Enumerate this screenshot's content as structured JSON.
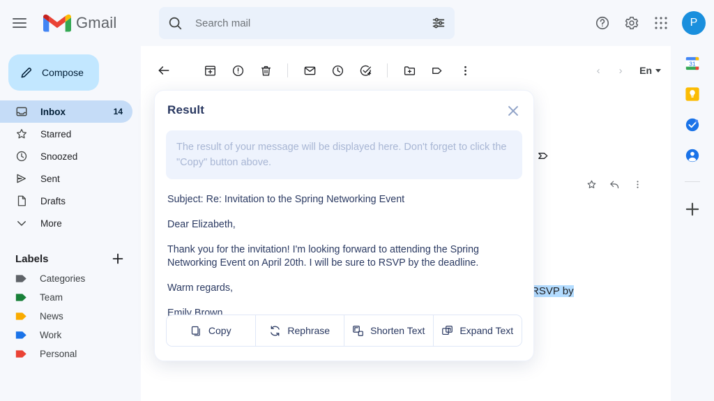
{
  "app": {
    "brand_name": "Gmail",
    "avatar_initial": "P"
  },
  "search": {
    "placeholder": "Search mail",
    "value": ""
  },
  "sidebar": {
    "compose_label": "Compose",
    "items": [
      {
        "label": "Inbox",
        "count": "14",
        "icon": "inbox-icon",
        "active": true
      },
      {
        "label": "Starred",
        "count": "",
        "icon": "star-icon",
        "active": false
      },
      {
        "label": "Snoozed",
        "count": "",
        "icon": "clock-icon",
        "active": false
      },
      {
        "label": "Sent",
        "count": "",
        "icon": "send-icon",
        "active": false
      },
      {
        "label": "Drafts",
        "count": "",
        "icon": "draft-icon",
        "active": false
      },
      {
        "label": "More",
        "count": "",
        "icon": "chevron-down-icon",
        "active": false
      }
    ],
    "labels_header": "Labels",
    "labels": [
      {
        "label": "Categories",
        "color": "#5f6368"
      },
      {
        "label": "Team",
        "color": "#188038"
      },
      {
        "label": "News",
        "color": "#f9ab00"
      },
      {
        "label": "Work",
        "color": "#1a73e8"
      },
      {
        "label": "Personal",
        "color": "#ea4335"
      }
    ]
  },
  "toolbar": {
    "buttons": [
      "back-icon",
      "archive-icon",
      "report-spam-icon",
      "delete-icon",
      "mark-unread-icon",
      "snooze-icon",
      "add-to-tasks-icon",
      "move-to-icon",
      "label-icon",
      "more-options-icon"
    ],
    "pager_prev": "‹",
    "pager_next": "›",
    "language_label": "En"
  },
  "message": {
    "body_before": "",
    "highlight": "RSVP by",
    "body_after": ""
  },
  "right_rail": {
    "items": [
      "calendar-icon",
      "keep-icon",
      "tasks-icon",
      "contacts-icon"
    ],
    "add_label": "+"
  },
  "modal": {
    "title": "Result",
    "close_label": "×",
    "placeholder_text": "The result of your message will be displayed here. Don't forget to click the \"Copy\" button above.",
    "email": {
      "subject": "Subject: Re: Invitation to the Spring Networking Event",
      "greeting": "Dear Elizabeth,",
      "paragraph": "Thank you for the invitation! I'm looking forward to attending the Spring Networking Event on April 20th. I will be sure to RSVP by the deadline.",
      "signoff": "Warm regards,",
      "signature": "Emily Brown"
    },
    "actions": [
      {
        "label": "Copy",
        "icon": "copy-icon"
      },
      {
        "label": "Rephrase",
        "icon": "refresh-icon"
      },
      {
        "label": "Shorten Text",
        "icon": "shorten-icon"
      },
      {
        "label": "Expand Text",
        "icon": "expand-icon"
      }
    ]
  },
  "colors": {
    "accent": "#1a73e8",
    "compose_bg": "#c2e7ff",
    "active_nav_bg": "#c5dcf7",
    "highlight": "#b3dcff",
    "modal_title": "#27365f",
    "avatar_bg": "#1a8fdd"
  }
}
